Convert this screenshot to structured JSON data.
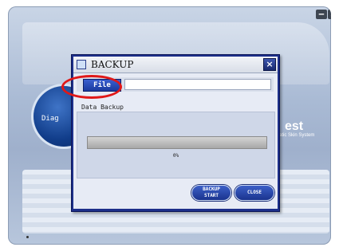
{
  "background_app": {
    "circle_text": "Diag",
    "brand_title": "est",
    "brand_subtitle": "atic Skin System",
    "minimize_glyph": "‒",
    "close_glyph": "×"
  },
  "dialog": {
    "title": "BACKUP",
    "close_glyph": "×",
    "file_button_label": "File",
    "file_path_value": "",
    "section_label": "Data Backup",
    "progress_percent": 0,
    "progress_text": "0%",
    "backup_start_label_line1": "BACKUP",
    "backup_start_label_line2": "START",
    "close_button_label": "CLOSE"
  },
  "colors": {
    "dialog_frame": "#1d2f8a",
    "button_blue": "#1a3a9e",
    "highlight": "#e01818"
  },
  "icons": [
    "window-icon",
    "close-icon",
    "minimize-icon"
  ]
}
